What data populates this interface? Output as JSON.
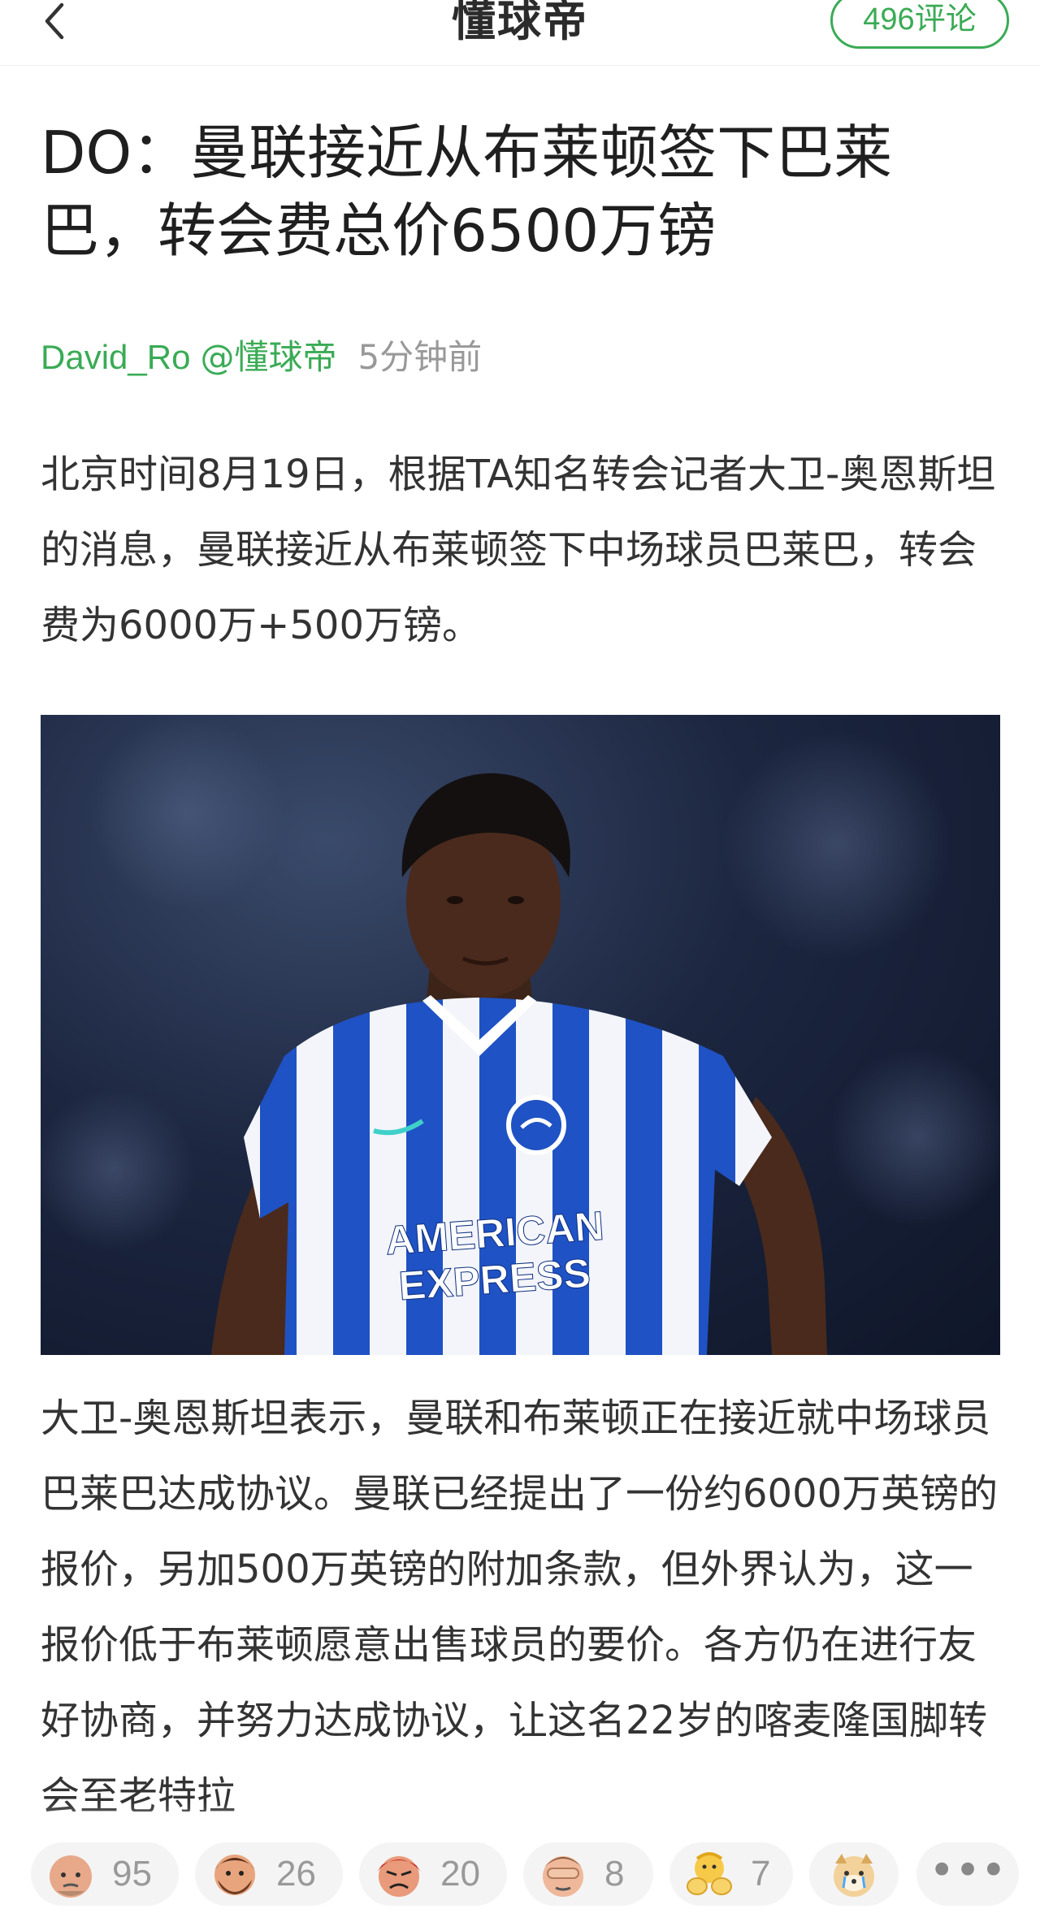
{
  "topbar": {
    "app_title": "懂球帝",
    "comments_count": "496",
    "comments_suffix": "评论"
  },
  "article": {
    "headline": "DO：曼联接近从布莱顿签下巴莱巴，转会费总价6500万镑",
    "author": "David_Ro",
    "source": "@懂球帝",
    "time": "5分钟前",
    "paragraph_1": "北京时间8月19日，根据TA知名转会记者大卫-奥恩斯坦的消息，曼联接近从布莱顿签下中场球员巴莱巴，转会费为6000万+500万镑。",
    "paragraph_2": "大卫-奥恩斯坦表示，曼联和布莱顿正在接近就中场球员巴莱巴达成协议。曼联已经提出了一份约6000万英镑的报价，另加500万英镑的附加条款，但外界认为，这一报价低于布莱顿愿意出售球员的要价。各方仍在进行友好协商，并努力达成协议，让这名22岁的喀麦隆国脚转会至老特拉",
    "photo": {
      "sponsor_line1": "AMERICAN",
      "sponsor_line2": "EXPRESS"
    }
  },
  "reactions": [
    {
      "icon": "bald-face-emoji-icon",
      "count": "95"
    },
    {
      "icon": "bearded-face-emoji-icon",
      "count": "26"
    },
    {
      "icon": "angry-face-emoji-icon",
      "count": "20"
    },
    {
      "icon": "facepalm-emoji-icon",
      "count": "8"
    },
    {
      "icon": "clapping-hands-emoji-icon",
      "count": "7"
    },
    {
      "icon": "crying-dog-emoji-icon",
      "count": ""
    }
  ],
  "more_label": "•••",
  "colors": {
    "accent": "#3aab55",
    "meta_gray": "#999999",
    "reaction_bg": "#f4f4f4"
  }
}
